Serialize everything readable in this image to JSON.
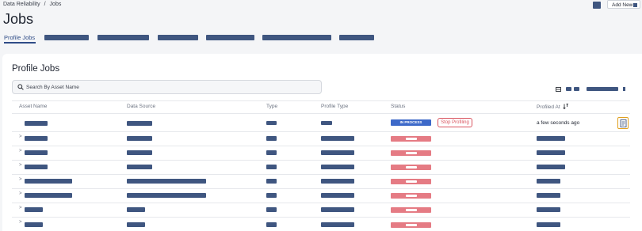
{
  "breadcrumb": {
    "parent": "Data Reliability",
    "separator": "/",
    "current": "Jobs"
  },
  "page_title": "Jobs",
  "header": {
    "add_new_label": "Add New"
  },
  "tabs": {
    "active_label": "Profile Jobs"
  },
  "card": {
    "title": "Profile Jobs",
    "search_placeholder": "Search By Asset Name"
  },
  "table": {
    "columns": [
      "Asset Name",
      "Data Source",
      "Type",
      "Profile Type",
      "Status",
      "Profiled At"
    ],
    "first_row": {
      "status": "IN PROCESS",
      "action_label": "Stop Profiling",
      "profiled_at": "a few seconds ago"
    }
  },
  "icons": {
    "search": "search-icon",
    "sort": "sort-icon",
    "chevron": "chevron-right-icon",
    "document": "document-icon",
    "table_settings": "table-settings-icon"
  },
  "colors": {
    "accent": "#2f4c87",
    "in_process": "#3d69c9",
    "stop": "#d9545f",
    "status_red": "#e57b84",
    "highlight": "#e0a020"
  }
}
